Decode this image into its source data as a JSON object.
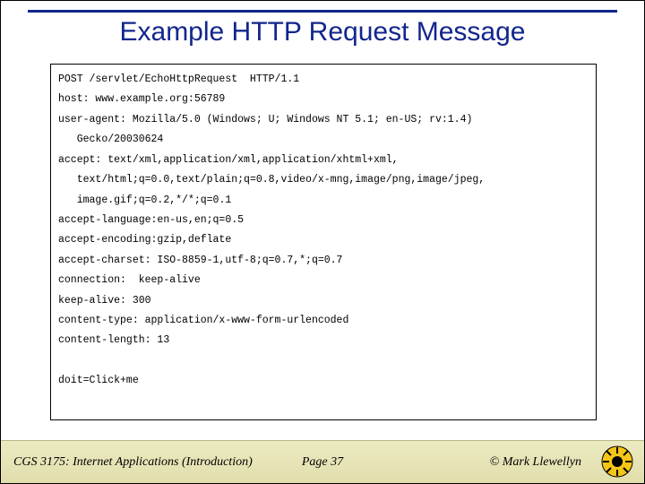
{
  "title": "Example HTTP Request Message",
  "http": {
    "request_line": "POST /servlet/EchoHttpRequest  HTTP/1.1",
    "headers": [
      "host: www.example.org:56789",
      "user-agent: Mozilla/5.0 (Windows; U; Windows NT 5.1; en-US; rv:1.4)",
      "   Gecko/20030624",
      "accept: text/xml,application/xml,application/xhtml+xml,",
      "   text/html;q=0.0,text/plain;q=0.8,video/x-mng,image/png,image/jpeg,",
      "   image.gif;q=0.2,*/*;q=0.1",
      "accept-language:en-us,en;q=0.5",
      "accept-encoding:gzip,deflate",
      "accept-charset: ISO-8859-1,utf-8;q=0.7,*;q=0.7",
      "connection:  keep-alive",
      "keep-alive: 300",
      "content-type: application/x-www-form-urlencoded",
      "content-length: 13"
    ],
    "body": "doit=Click+me"
  },
  "footer": {
    "course": "CGS 3175: Internet Applications (Introduction)",
    "page": "Page 37",
    "author": "© Mark Llewellyn"
  }
}
